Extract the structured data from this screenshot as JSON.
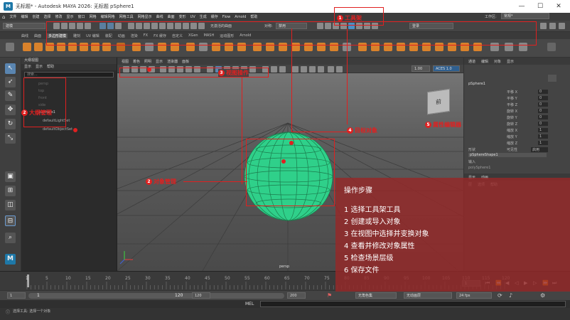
{
  "window": {
    "title": "无标题* - Autodesk MAYA 2026: 无标题   pSphere1",
    "logo": "M",
    "controls": [
      "—",
      "☐",
      "✕"
    ]
  },
  "menubar": {
    "items": [
      "文件",
      "编辑",
      "创建",
      "选择",
      "修改",
      "显示",
      "窗口",
      "网格",
      "编辑网格",
      "网格工具",
      "网格显示",
      "曲线",
      "曲面",
      "变形",
      "UV",
      "生成",
      "缓存",
      "Flow",
      "Arnold",
      "帮助"
    ]
  },
  "toolbar": {
    "mode": "建模",
    "no_live": "无激活的曲面",
    "symmetry_label": "对称:",
    "symmetry_value": "禁用",
    "user": "登录",
    "workspace_label": "工作区:",
    "workspace_value": "常规*"
  },
  "shelf_tabs": [
    "曲线",
    "曲面",
    "多边形建模",
    "雕刻",
    "UV 编辑",
    "装配",
    "动画",
    "渲染",
    "FX",
    "FX 缓存",
    "自定义",
    "XGen",
    "MASH",
    "运动图形",
    "Arnold"
  ],
  "outliner": {
    "title": "大纲视图",
    "menu": [
      "显示",
      "显示",
      "帮助"
    ],
    "search_placeholder": "搜索...",
    "items": [
      "persp",
      "top",
      "front",
      "side",
      "pSphere1",
      "defaultLightSet",
      "defaultObjectSet"
    ]
  },
  "viewport": {
    "menu": [
      "视图",
      "着色",
      "照明",
      "显示",
      "渲染器",
      "面板"
    ],
    "camera_label": "persp",
    "gamma_value": "1.00",
    "colorspace": "ACES 1.0"
  },
  "view_cube": {
    "face": "前"
  },
  "attribute_panel": {
    "tabs": [
      "通道",
      "编辑",
      "对象",
      "显示"
    ],
    "object_name": "pSphere1",
    "channels": [
      {
        "label": "平移 X",
        "value": "0"
      },
      {
        "label": "平移 Y",
        "value": "0"
      },
      {
        "label": "平移 Z",
        "value": "0"
      },
      {
        "label": "旋转 X",
        "value": "0"
      },
      {
        "label": "旋转 Y",
        "value": "0"
      },
      {
        "label": "旋转 Z",
        "value": "0"
      },
      {
        "label": "缩放 X",
        "value": "1"
      },
      {
        "label": "缩放 Y",
        "value": "1"
      },
      {
        "label": "缩放 Z",
        "value": "1"
      },
      {
        "label": "可见性",
        "value": "启用"
      }
    ],
    "shapes_label": "形状",
    "shape_name": "pSphereShape1",
    "inputs_label": "输入",
    "input_name": "polySphere1",
    "layer_tabs": [
      "显示",
      "动画"
    ],
    "layer_menu": [
      "层",
      "选项",
      "帮助"
    ]
  },
  "timeline": {
    "ticks": [
      "1",
      "5",
      "10",
      "15",
      "20",
      "25",
      "30",
      "35",
      "40",
      "45",
      "50",
      "55",
      "60",
      "65",
      "70",
      "75",
      "80",
      "85",
      "90",
      "95",
      "100",
      "105",
      "110",
      "115",
      "120"
    ],
    "current_frame": "1"
  },
  "range": {
    "start": "1",
    "inner_start": "1",
    "inner_end": "120",
    "end_field": "120",
    "end": "200",
    "char_set": "无角色集",
    "anim_layer": "无动画层",
    "fps": "24 fps"
  },
  "cmdline": {
    "lang": "MEL"
  },
  "status": {
    "text": "选择工具: 选择一个对象"
  },
  "annotations": [
    {
      "num": "1",
      "label": "工具架"
    },
    {
      "num": "2",
      "label": "大纲管理"
    },
    {
      "num": "3",
      "label": "视图操作"
    },
    {
      "num": "4",
      "label": "目标对象"
    },
    {
      "num": "5",
      "label": "属性编辑器"
    },
    {
      "num": "2",
      "label": "对象管理"
    }
  ],
  "steps": {
    "title": "操作步骤",
    "items": [
      "1  选择工具架工具",
      "2  创建或导入对象",
      "3  在视图中选择并变换对象",
      "4  查看并修改对象属性",
      "5  检查场景层级",
      "6  保存文件"
    ]
  },
  "colors": {
    "accent_red": "#e02020",
    "sphere": "#2fd08a",
    "maya_blue": "#1e78a8",
    "steps_bg": "#962828"
  }
}
